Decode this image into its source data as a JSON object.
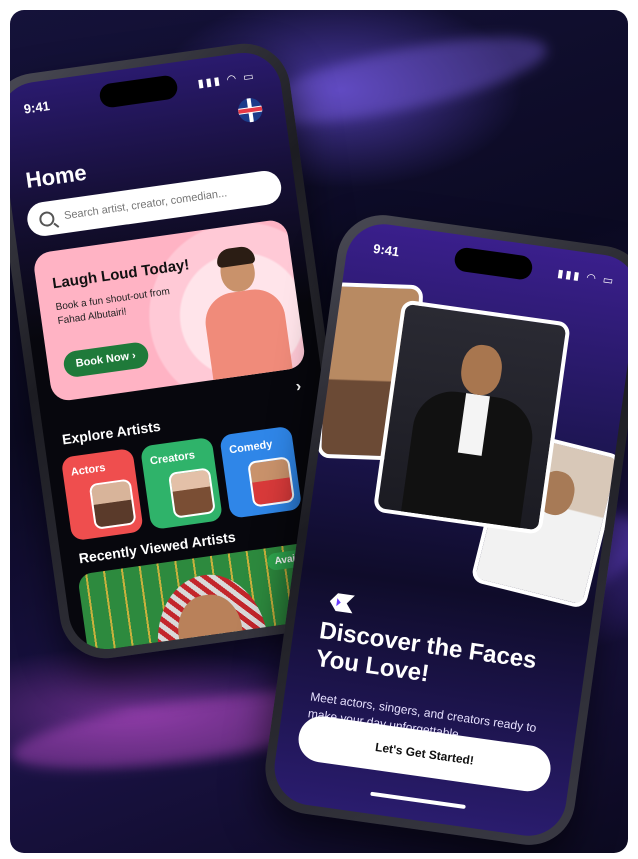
{
  "home_screen": {
    "status_time": "9:41",
    "status_icons": "▮▮▮ ◠ ▭",
    "language_flag": "uk-flag-icon",
    "title": "Home",
    "search": {
      "placeholder": "Search artist, creator, comedian..."
    },
    "banner": {
      "title": "Laugh Loud Today!",
      "text": "Book a fun shout-out from Fahad Albutairi!",
      "button_label": "Book Now ›",
      "background": "#ffb3c4"
    },
    "next_chevron": "›",
    "explore": {
      "title": "Explore Artists",
      "categories": [
        {
          "label": "Actors",
          "color": "#ef4e4e"
        },
        {
          "label": "Creators",
          "color": "#2fb36a"
        },
        {
          "label": "Comedy",
          "color": "#2f86e8"
        }
      ]
    },
    "recent": {
      "title": "Recently Viewed Artists",
      "badge": "Available"
    }
  },
  "onboarding_screen": {
    "status_time": "9:41",
    "status_icons": "▮▮▮ ◠ ▭",
    "title": "Discover the Faces You Love!",
    "subtitle": "Meet actors, singers, and creators ready to make your day unforgettable.",
    "cta_label": "Let's Get Started!"
  },
  "colors": {
    "accent_purple": "#6a3cff",
    "cta_bg": "#ffffff",
    "book_button": "#1f7a3a",
    "available_badge": "#2fa84f"
  }
}
